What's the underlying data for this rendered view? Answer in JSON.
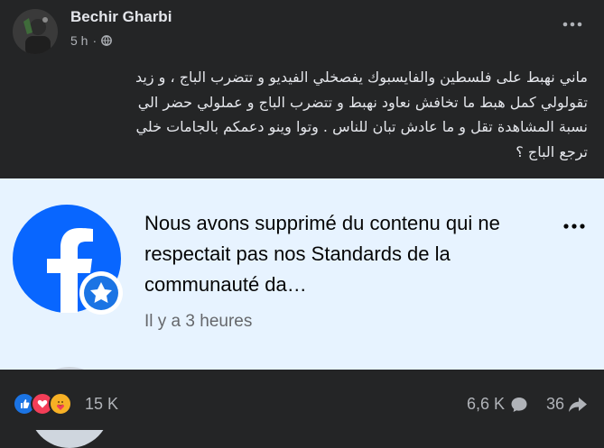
{
  "post": {
    "author": "Bechir Gharbi",
    "time": "5 h",
    "dot": "·",
    "text": "ماني نهبط على فلسطين والفايسبوك  يفصخلي الفيديو و تتضرب الباج ، و زيد\nتقولولي كمل هبط ما تخافش نعاود نهبط و تتضرب الباج و عملولي حضر الي\nنسبة المشاهدة تقل و ما عادش تبان للناس . وتوا وينو دعمكم بالجامات خلي\nترجع الباج ؟"
  },
  "notice": {
    "title": "Nous avons supprimé du contenu qui ne respectait pas nos Standards de la communauté da…",
    "time": "Il y a 3 heures"
  },
  "footer": {
    "reactions_count": "15 K",
    "comments_count": "6,6 K",
    "shares_count": "36"
  },
  "icons": {
    "like": "like-icon",
    "love": "love-icon",
    "care": "care-icon",
    "comment": "comment-icon",
    "share": "share-icon"
  },
  "colors": {
    "background": "#242526",
    "notice_bg": "#e7f3ff",
    "facebook_blue": "#0866ff",
    "like_blue": "#1b74e4",
    "love_red": "#f33e58",
    "care_yellow": "#f7b125"
  }
}
